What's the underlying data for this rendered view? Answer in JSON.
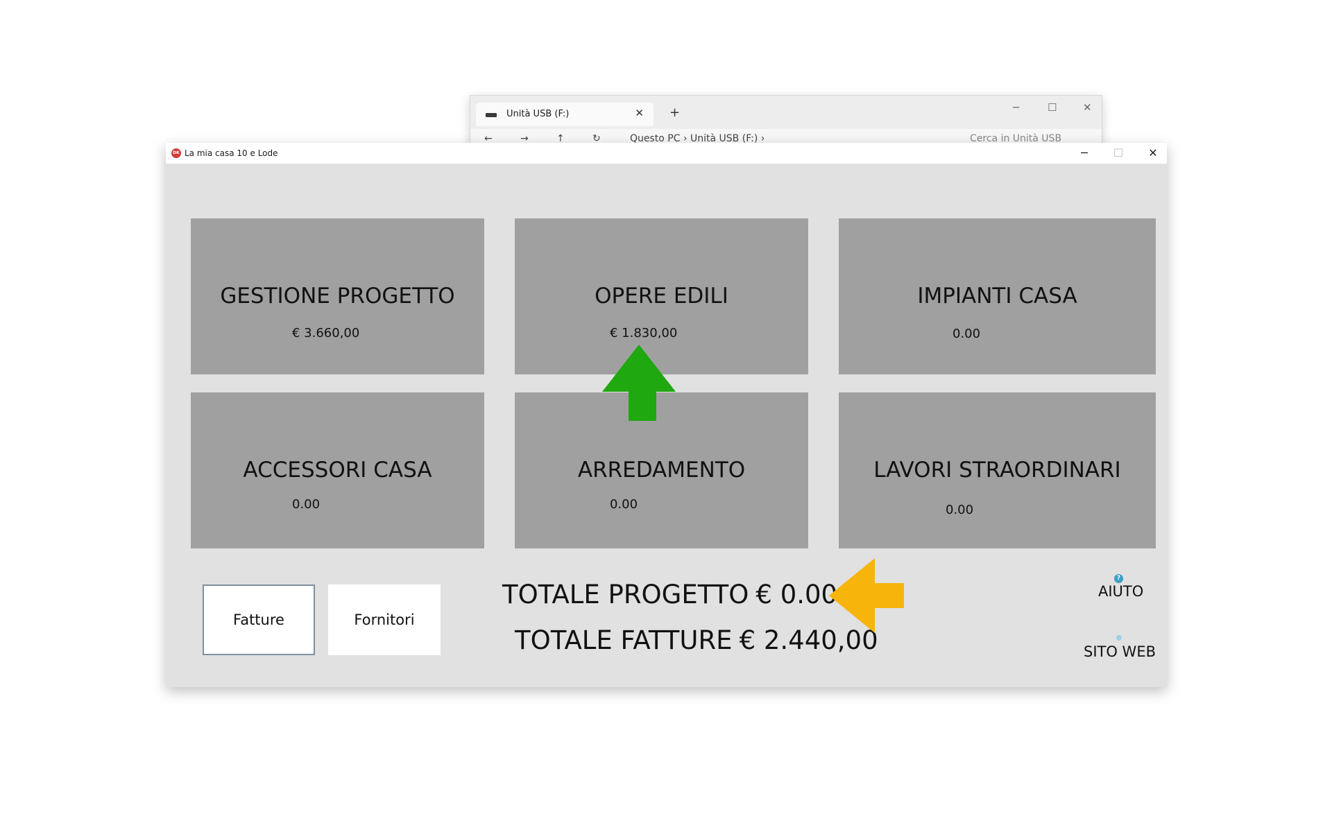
{
  "explorer": {
    "tab_label": "Unità USB (F:)",
    "tab_close": "✕",
    "new_tab": "+",
    "minimize": "─",
    "maximize": "☐",
    "close": "✕",
    "back": "←",
    "forward": "→",
    "up": "↑",
    "refresh": "↻",
    "address": "Questo PC  ›  Unità USB (F:)  ›",
    "search_placeholder": "Cerca in Unità USB"
  },
  "app": {
    "title": "La mia casa 10 e Lode",
    "logo_text": "DK",
    "minimize": "─",
    "maximize": "☐",
    "close": "✕"
  },
  "tiles": [
    {
      "title": "GESTIONE PROGETTO",
      "value": "€ 3.660,00"
    },
    {
      "title": "OPERE EDILI",
      "value": "€ 1.830,00"
    },
    {
      "title": "IMPIANTI CASA",
      "value": "0.00"
    },
    {
      "title": "ACCESSORI CASA",
      "value": "0.00"
    },
    {
      "title": "ARREDAMENTO",
      "value": "0.00"
    },
    {
      "title": "LAVORI STRAORDINARI",
      "value": "0.00"
    }
  ],
  "buttons": {
    "fatture": "Fatture",
    "fornitori": "Fornitori"
  },
  "totals": {
    "progetto_label": "TOTALE PROGETTO",
    "progetto_value": "€ 0.00",
    "fatture_label": "TOTALE FATTURE",
    "fatture_value": "€ 2.440,00"
  },
  "side": {
    "help_icon": "?",
    "help_label": "AIUTO",
    "web_label": "SITO WEB"
  },
  "colors": {
    "green_arrow": "#1fa80f",
    "orange_arrow": "#f7b50c",
    "tile": "#a0a0a0",
    "window_bg": "#e1e1e1"
  }
}
